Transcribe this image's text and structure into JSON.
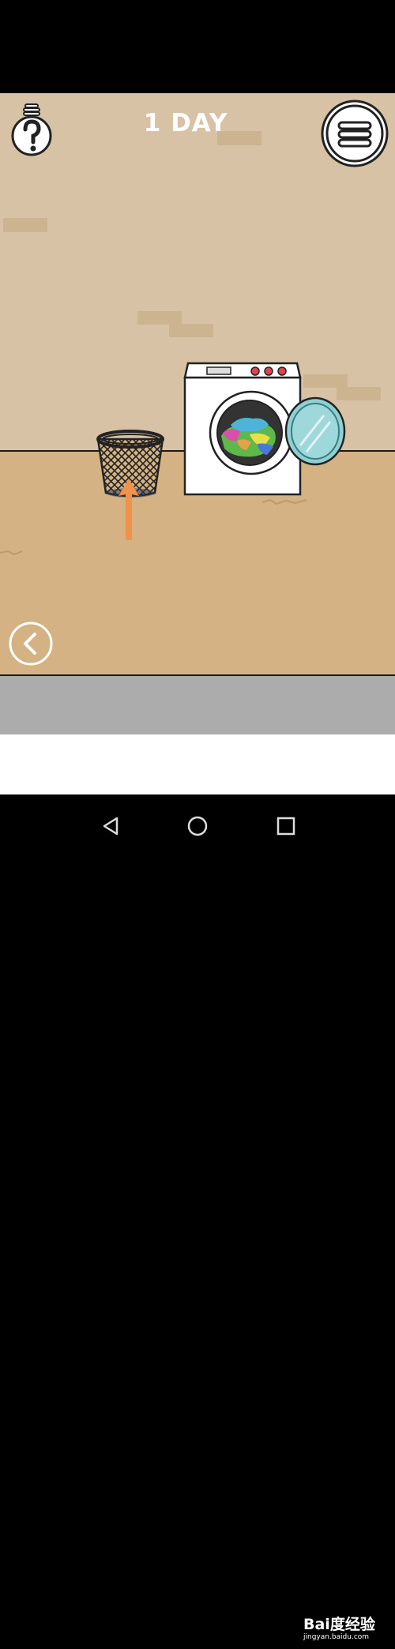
{
  "game": {
    "day_label": "1 DAY",
    "hint_icon": "lightbulb-question-icon",
    "menu_icon": "hamburger-menu-icon",
    "back_icon": "chevron-left-icon",
    "scene_items": {
      "basket": "wire-wastebasket",
      "washer": "front-load-washing-machine",
      "arrow": "up-arrow-hint-icon"
    }
  },
  "colors": {
    "wall": "#d7c2a5",
    "floor": "#d5b283",
    "arrow": "#f0924a",
    "washer_glass": "#8ed0d3",
    "bottom_panel": "#acacac"
  },
  "nav": {
    "back_icon": "triangle-back-icon",
    "home_icon": "circle-home-icon",
    "recents_icon": "square-recents-icon"
  },
  "watermark": {
    "brand": "Bai度经验",
    "url": "jingyan.baidu.com"
  }
}
